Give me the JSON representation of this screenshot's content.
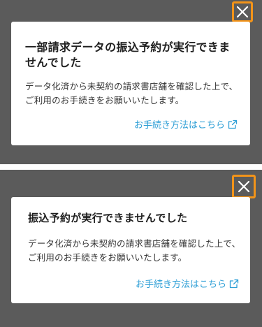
{
  "dialogs": [
    {
      "title": "一部請求データの振込予約が実行できませんでした",
      "body": "データ化済から未契約の請求書店舗を確認した上で、ご利用のお手続きをお願いいたします。",
      "link_label": "お手続き方法はこちら"
    },
    {
      "title": "振込予約が実行できませんでした",
      "body": "データ化済から未契約の請求書店舗を確認した上で、ご利用のお手続きをお願いいたします。",
      "link_label": "お手続き方法はこちら"
    }
  ],
  "colors": {
    "overlay": "#5b5b5b",
    "highlight": "#f39419",
    "link": "#2e9fd6"
  },
  "icons": {
    "close": "close-icon",
    "external_link": "external-link-icon"
  }
}
